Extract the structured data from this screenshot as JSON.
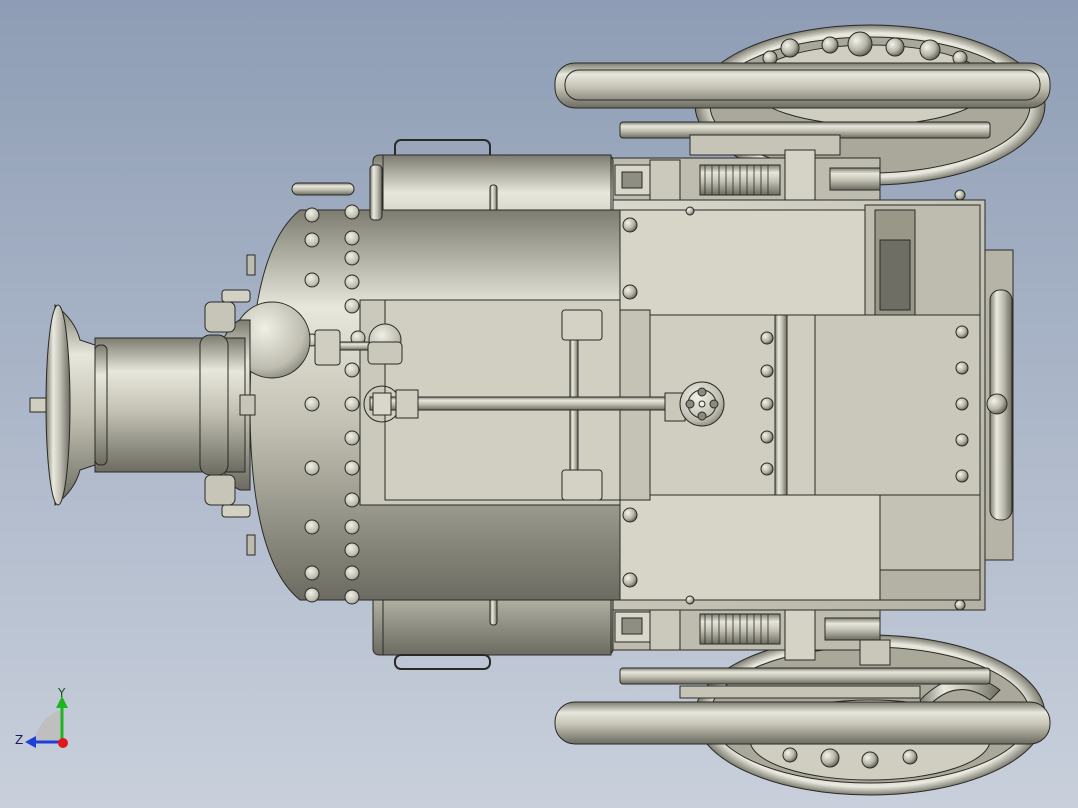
{
  "viewport": {
    "background_top": "#8e9db5",
    "background_bottom": "#c9d0dc",
    "metal_light": "#e9e8de",
    "metal_mid": "#b9b8aa",
    "metal_dark": "#6f6e64",
    "edge": "#2a2a26"
  },
  "triad": {
    "y_label": "Y",
    "z_label": "Z",
    "y_color": "#1fb51f",
    "z_color": "#1f3fd8",
    "x_color": "#e01818"
  }
}
